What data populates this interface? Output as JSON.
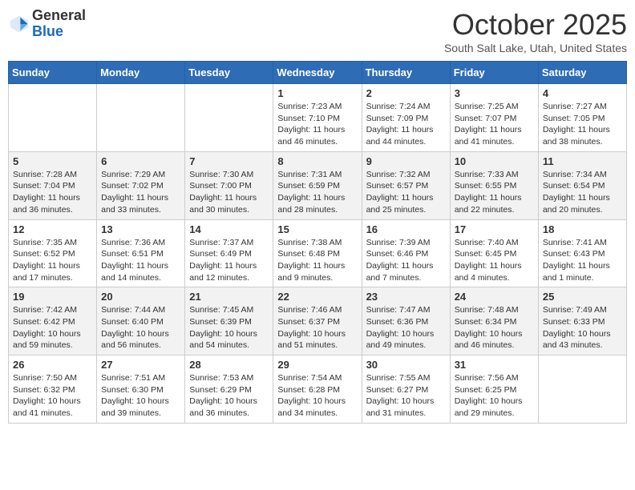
{
  "header": {
    "logo_general": "General",
    "logo_blue": "Blue",
    "month": "October 2025",
    "location": "South Salt Lake, Utah, United States"
  },
  "days_of_week": [
    "Sunday",
    "Monday",
    "Tuesday",
    "Wednesday",
    "Thursday",
    "Friday",
    "Saturday"
  ],
  "weeks": [
    [
      {
        "day": "",
        "info": ""
      },
      {
        "day": "",
        "info": ""
      },
      {
        "day": "",
        "info": ""
      },
      {
        "day": "1",
        "info": "Sunrise: 7:23 AM\nSunset: 7:10 PM\nDaylight: 11 hours and 46 minutes."
      },
      {
        "day": "2",
        "info": "Sunrise: 7:24 AM\nSunset: 7:09 PM\nDaylight: 11 hours and 44 minutes."
      },
      {
        "day": "3",
        "info": "Sunrise: 7:25 AM\nSunset: 7:07 PM\nDaylight: 11 hours and 41 minutes."
      },
      {
        "day": "4",
        "info": "Sunrise: 7:27 AM\nSunset: 7:05 PM\nDaylight: 11 hours and 38 minutes."
      }
    ],
    [
      {
        "day": "5",
        "info": "Sunrise: 7:28 AM\nSunset: 7:04 PM\nDaylight: 11 hours and 36 minutes."
      },
      {
        "day": "6",
        "info": "Sunrise: 7:29 AM\nSunset: 7:02 PM\nDaylight: 11 hours and 33 minutes."
      },
      {
        "day": "7",
        "info": "Sunrise: 7:30 AM\nSunset: 7:00 PM\nDaylight: 11 hours and 30 minutes."
      },
      {
        "day": "8",
        "info": "Sunrise: 7:31 AM\nSunset: 6:59 PM\nDaylight: 11 hours and 28 minutes."
      },
      {
        "day": "9",
        "info": "Sunrise: 7:32 AM\nSunset: 6:57 PM\nDaylight: 11 hours and 25 minutes."
      },
      {
        "day": "10",
        "info": "Sunrise: 7:33 AM\nSunset: 6:55 PM\nDaylight: 11 hours and 22 minutes."
      },
      {
        "day": "11",
        "info": "Sunrise: 7:34 AM\nSunset: 6:54 PM\nDaylight: 11 hours and 20 minutes."
      }
    ],
    [
      {
        "day": "12",
        "info": "Sunrise: 7:35 AM\nSunset: 6:52 PM\nDaylight: 11 hours and 17 minutes."
      },
      {
        "day": "13",
        "info": "Sunrise: 7:36 AM\nSunset: 6:51 PM\nDaylight: 11 hours and 14 minutes."
      },
      {
        "day": "14",
        "info": "Sunrise: 7:37 AM\nSunset: 6:49 PM\nDaylight: 11 hours and 12 minutes."
      },
      {
        "day": "15",
        "info": "Sunrise: 7:38 AM\nSunset: 6:48 PM\nDaylight: 11 hours and 9 minutes."
      },
      {
        "day": "16",
        "info": "Sunrise: 7:39 AM\nSunset: 6:46 PM\nDaylight: 11 hours and 7 minutes."
      },
      {
        "day": "17",
        "info": "Sunrise: 7:40 AM\nSunset: 6:45 PM\nDaylight: 11 hours and 4 minutes."
      },
      {
        "day": "18",
        "info": "Sunrise: 7:41 AM\nSunset: 6:43 PM\nDaylight: 11 hours and 1 minute."
      }
    ],
    [
      {
        "day": "19",
        "info": "Sunrise: 7:42 AM\nSunset: 6:42 PM\nDaylight: 10 hours and 59 minutes."
      },
      {
        "day": "20",
        "info": "Sunrise: 7:44 AM\nSunset: 6:40 PM\nDaylight: 10 hours and 56 minutes."
      },
      {
        "day": "21",
        "info": "Sunrise: 7:45 AM\nSunset: 6:39 PM\nDaylight: 10 hours and 54 minutes."
      },
      {
        "day": "22",
        "info": "Sunrise: 7:46 AM\nSunset: 6:37 PM\nDaylight: 10 hours and 51 minutes."
      },
      {
        "day": "23",
        "info": "Sunrise: 7:47 AM\nSunset: 6:36 PM\nDaylight: 10 hours and 49 minutes."
      },
      {
        "day": "24",
        "info": "Sunrise: 7:48 AM\nSunset: 6:34 PM\nDaylight: 10 hours and 46 minutes."
      },
      {
        "day": "25",
        "info": "Sunrise: 7:49 AM\nSunset: 6:33 PM\nDaylight: 10 hours and 43 minutes."
      }
    ],
    [
      {
        "day": "26",
        "info": "Sunrise: 7:50 AM\nSunset: 6:32 PM\nDaylight: 10 hours and 41 minutes."
      },
      {
        "day": "27",
        "info": "Sunrise: 7:51 AM\nSunset: 6:30 PM\nDaylight: 10 hours and 39 minutes."
      },
      {
        "day": "28",
        "info": "Sunrise: 7:53 AM\nSunset: 6:29 PM\nDaylight: 10 hours and 36 minutes."
      },
      {
        "day": "29",
        "info": "Sunrise: 7:54 AM\nSunset: 6:28 PM\nDaylight: 10 hours and 34 minutes."
      },
      {
        "day": "30",
        "info": "Sunrise: 7:55 AM\nSunset: 6:27 PM\nDaylight: 10 hours and 31 minutes."
      },
      {
        "day": "31",
        "info": "Sunrise: 7:56 AM\nSunset: 6:25 PM\nDaylight: 10 hours and 29 minutes."
      },
      {
        "day": "",
        "info": ""
      }
    ]
  ]
}
